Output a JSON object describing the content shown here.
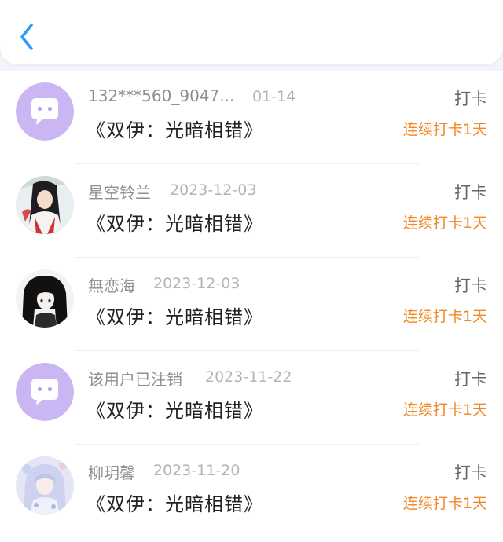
{
  "colors": {
    "accent_blue": "#2f9bff",
    "streak_orange": "#f08a28",
    "placeholder_avatar": "#c9b6f2"
  },
  "header": {
    "back_icon": "chevron-left-icon"
  },
  "list": [
    {
      "name": "132***560_9047...",
      "date": "01-14",
      "title": "《双伊：光暗相错》",
      "action": "打卡",
      "streak": "连续打卡1天",
      "avatar": "chat-bubble-placeholder"
    },
    {
      "name": "星空铃兰",
      "date": "2023-12-03",
      "title": "《双伊：光暗相错》",
      "action": "打卡",
      "streak": "连续打卡1天",
      "avatar": "anime-girl-red-white"
    },
    {
      "name": "無恋海",
      "date": "2023-12-03",
      "title": "《双伊：光暗相错》",
      "action": "打卡",
      "streak": "连续打卡1天",
      "avatar": "anime-girl-black-hair"
    },
    {
      "name": "该用户已注销",
      "date": "2023-11-22",
      "title": "《双伊：光暗相错》",
      "action": "打卡",
      "streak": "连续打卡1天",
      "avatar": "chat-bubble-placeholder"
    },
    {
      "name": "柳玥馨",
      "date": "2023-11-20",
      "title": "《双伊：光暗相错》",
      "action": "打卡",
      "streak": "连续打卡1天",
      "avatar": "anime-girl-lilac"
    }
  ]
}
